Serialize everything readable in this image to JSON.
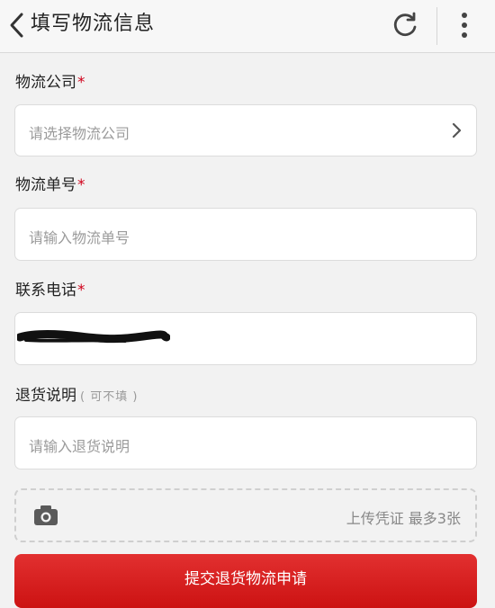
{
  "header": {
    "title": "填写物流信息",
    "back_icon": "chevron-left-icon",
    "refresh_icon": "refresh-icon",
    "more_icon": "more-vertical-icon"
  },
  "form": {
    "company": {
      "label": "物流公司",
      "required_mark": "*",
      "placeholder": "请选择物流公司"
    },
    "tracking": {
      "label": "物流单号",
      "required_mark": "*",
      "placeholder": "请输入物流单号"
    },
    "phone": {
      "label": "联系电话",
      "required_mark": "*",
      "value_note": "masked"
    },
    "reason": {
      "label": "退货说明",
      "optional_note": "( 可不填 )",
      "placeholder": "请输入退货说明"
    }
  },
  "upload": {
    "label": "上传凭证 最多3张",
    "icon": "camera-icon"
  },
  "submit_label": "提交退货物流申请",
  "colors": {
    "accent": "#d0021b",
    "button": "#d91f1f"
  }
}
